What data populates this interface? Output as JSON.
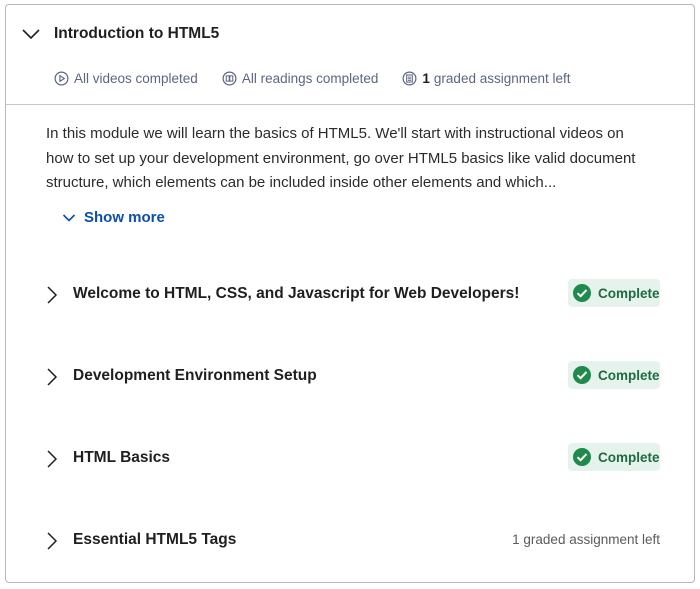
{
  "module": {
    "title": "Introduction to HTML5",
    "stats": {
      "videos": "All videos completed",
      "readings": "All readings completed",
      "graded_count": "1",
      "graded_text": "graded assignment left"
    },
    "description": "In this module we will learn the basics of HTML5. We'll start with instructional videos on how to set up your development environment, go over HTML5 basics like valid document structure, which elements can be included inside other elements and which...",
    "show_more": "Show more"
  },
  "lessons": [
    {
      "title": "Welcome to HTML, CSS, and Javascript for Web Developers!",
      "status": "Complete"
    },
    {
      "title": "Development Environment Setup",
      "status": "Complete"
    },
    {
      "title": "HTML Basics",
      "status": "Complete"
    },
    {
      "title": "Essential HTML5 Tags",
      "note": "1 graded assignment left"
    }
  ],
  "colors": {
    "link": "#0b4fa8",
    "complete_bg": "#e6f3ec",
    "complete_icon": "#1f8a4c",
    "complete_text": "#1f6b3f"
  }
}
